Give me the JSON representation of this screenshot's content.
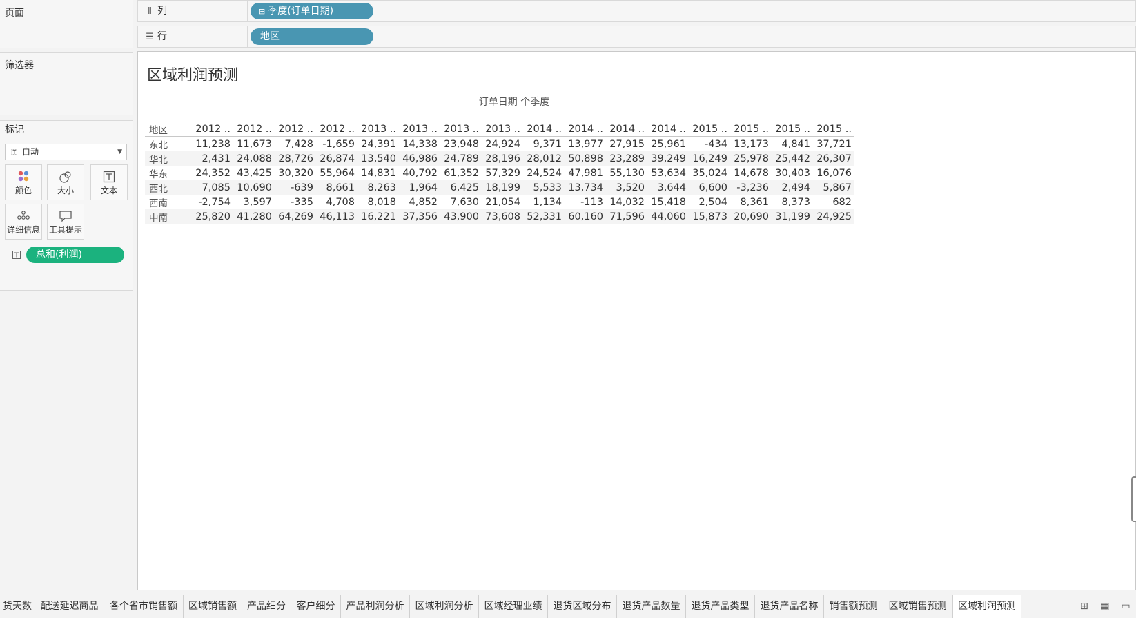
{
  "sidebar": {
    "pages_title": "页面",
    "filters_title": "筛选器",
    "marks_title": "标记",
    "mark_type": "自动",
    "mark_buttons": [
      "颜色",
      "大小",
      "文本",
      "详细信息",
      "工具提示"
    ],
    "mark_pill": "总和(利润)"
  },
  "shelves": {
    "columns_label": "列",
    "columns_pill": "季度(订单日期)",
    "rows_label": "行",
    "rows_pill": "地区"
  },
  "view": {
    "title": "区域利润预测",
    "column_caption": "订单日期 个季度",
    "row_header": "地区",
    "columns": [
      "2012 ..",
      "2012 ..",
      "2012 ..",
      "2012 ..",
      "2013 ..",
      "2013 ..",
      "2013 ..",
      "2013 ..",
      "2014 ..",
      "2014 ..",
      "2014 ..",
      "2014 ..",
      "2015 ..",
      "2015 ..",
      "2015 ..",
      "2015 .."
    ],
    "rows": [
      {
        "label": "东北",
        "values": [
          "11,238",
          "11,673",
          "7,428",
          "-1,659",
          "24,391",
          "14,338",
          "23,948",
          "24,924",
          "9,371",
          "13,977",
          "27,915",
          "25,961",
          "-434",
          "13,173",
          "4,841",
          "37,721"
        ]
      },
      {
        "label": "华北",
        "values": [
          "2,431",
          "24,088",
          "28,726",
          "26,874",
          "13,540",
          "46,986",
          "24,789",
          "28,196",
          "28,012",
          "50,898",
          "23,289",
          "39,249",
          "16,249",
          "25,978",
          "25,442",
          "26,307"
        ]
      },
      {
        "label": "华东",
        "values": [
          "24,352",
          "43,425",
          "30,320",
          "55,964",
          "14,831",
          "40,792",
          "61,352",
          "57,329",
          "24,524",
          "47,981",
          "55,130",
          "53,634",
          "35,024",
          "14,678",
          "30,403",
          "16,076"
        ]
      },
      {
        "label": "西北",
        "values": [
          "7,085",
          "10,690",
          "-639",
          "8,661",
          "8,263",
          "1,964",
          "6,425",
          "18,199",
          "5,533",
          "13,734",
          "3,520",
          "3,644",
          "6,600",
          "-3,236",
          "2,494",
          "5,867"
        ]
      },
      {
        "label": "西南",
        "values": [
          "-2,754",
          "3,597",
          "-335",
          "4,708",
          "8,018",
          "4,852",
          "7,630",
          "21,054",
          "1,134",
          "-113",
          "14,032",
          "15,418",
          "2,504",
          "8,361",
          "8,373",
          "682"
        ]
      },
      {
        "label": "中南",
        "values": [
          "25,820",
          "41,280",
          "64,269",
          "46,113",
          "16,221",
          "37,356",
          "43,900",
          "73,608",
          "52,331",
          "60,160",
          "71,596",
          "44,060",
          "15,873",
          "20,690",
          "31,199",
          "24,925"
        ]
      }
    ]
  },
  "tabs": {
    "items": [
      "货天数",
      "配送延迟商品",
      "各个省市销售额",
      "区域销售额",
      "产品细分",
      "客户细分",
      "产品利润分析",
      "区域利润分析",
      "区域经理业绩",
      "退货区域分布",
      "退货产品数量",
      "退货产品类型",
      "退货产品名称",
      "销售额预测",
      "区域销售预测",
      "区域利润预测"
    ],
    "active_index": 15
  },
  "icons": {
    "columns_shelf": "columns-icon",
    "rows_shelf": "rows-icon",
    "text_mark": "text-mark-icon",
    "color": "color-dots-icon",
    "size": "size-icon",
    "detail": "detail-icon",
    "tooltip": "tooltip-icon"
  },
  "colors": {
    "pill_dimension": "#4996b2",
    "pill_measure": "#1bb27e"
  }
}
